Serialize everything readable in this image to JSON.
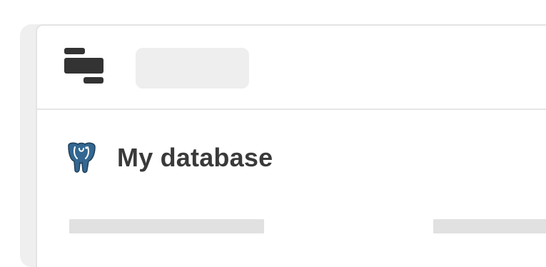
{
  "window": {
    "logo_icon": "stacked-bars-logo-icon",
    "toolbar_placeholder": ""
  },
  "database": {
    "icon": "postgresql-elephant-icon",
    "title": "My database"
  },
  "colors": {
    "background": "#ffffff",
    "back_card": "#efefef",
    "border": "#e4e4e4",
    "logo": "#333333",
    "placeholder": "#eeeeee",
    "skeleton": "#e1e1e1",
    "title_text": "#3a3a3a",
    "postgres_blue": "#336791"
  },
  "skeleton_rows": [
    {
      "name": "skeleton-line-1"
    },
    {
      "name": "skeleton-line-2"
    }
  ]
}
